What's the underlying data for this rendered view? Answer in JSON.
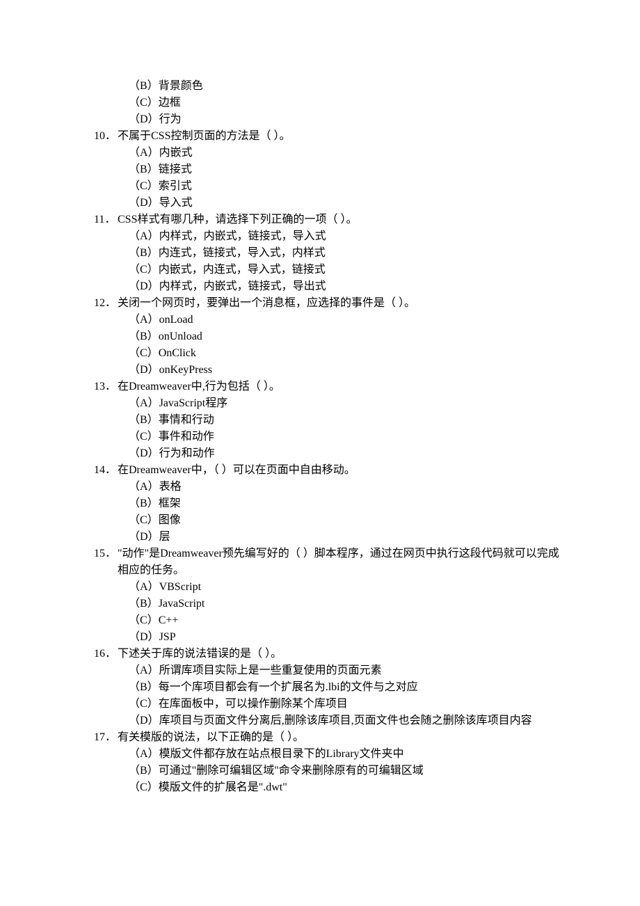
{
  "preOptions": [
    {
      "label": "（B）",
      "text": "背景颜色"
    },
    {
      "label": "（C）",
      "text": "边框"
    },
    {
      "label": "（D）",
      "text": "行为"
    }
  ],
  "questions": [
    {
      "num": "10．",
      "text": "不属于CSS控制页面的方法是（  ）。",
      "options": [
        {
          "label": "（A）",
          "text": "内嵌式"
        },
        {
          "label": "（B）",
          "text": "链接式"
        },
        {
          "label": "（C）",
          "text": "索引式"
        },
        {
          "label": "（D）",
          "text": "导入式"
        }
      ]
    },
    {
      "num": "11．",
      "text": "CSS样式有哪几种，请选择下列正确的一项（  ）。",
      "options": [
        {
          "label": "（A）",
          "text": "内样式，内嵌式，链接式，导入式"
        },
        {
          "label": "（B）",
          "text": "内连式，链接式，导入式，内样式"
        },
        {
          "label": "（C）",
          "text": "内嵌式，内连式，导入式，链接式"
        },
        {
          "label": "（D）",
          "text": "内样式，内嵌式，链接式，导出式"
        }
      ]
    },
    {
      "num": "12．",
      "text": "关闭一个网页时，要弹出一个消息框，应选择的事件是（  ）。",
      "options": [
        {
          "label": "（A）",
          "text": "onLoad"
        },
        {
          "label": "（B）",
          "text": "onUnload"
        },
        {
          "label": "（C）",
          "text": "OnClick"
        },
        {
          "label": "（D）",
          "text": "onKeyPress"
        }
      ]
    },
    {
      "num": "13．",
      "text": "在Dreamweaver中,行为包括（  ）。",
      "options": [
        {
          "label": "（A）",
          "text": "JavaScript程序"
        },
        {
          "label": "（B）",
          "text": "事情和行动"
        },
        {
          "label": "（C）",
          "text": "事件和动作"
        },
        {
          "label": "（D）",
          "text": "行为和动作"
        }
      ]
    },
    {
      "num": "14．",
      "text": "在Dreamweaver中，（  ）可以在页面中自由移动。",
      "options": [
        {
          "label": "（A）",
          "text": "表格"
        },
        {
          "label": "（B）",
          "text": "框架"
        },
        {
          "label": "（C）",
          "text": "图像"
        },
        {
          "label": "（D）",
          "text": "层"
        }
      ]
    },
    {
      "num": "15．",
      "text": "\"动作\"是Dreamweaver预先编写好的（  ）脚本程序，通过在网页中执行这段代码就可以完成相应的任务。",
      "options": [
        {
          "label": "（A）",
          "text": "VBScript"
        },
        {
          "label": "（B）",
          "text": "JavaScript"
        },
        {
          "label": "（C）",
          "text": "C++"
        },
        {
          "label": "（D）",
          "text": "JSP"
        }
      ]
    },
    {
      "num": "16．",
      "text": "下述关于库的说法错误的是（  ）。",
      "options": [
        {
          "label": "（A）",
          "text": "所谓库项目实际上是一些重复使用的页面元素"
        },
        {
          "label": "（B）",
          "text": "每一个库项目都会有一个扩展名为.lbi的文件与之对应"
        },
        {
          "label": "（C）",
          "text": "在库面板中，可以操作删除某个库项目"
        },
        {
          "label": "（D）",
          "text": "库项目与页面文件分离后,删除该库项目,页面文件也会随之删除该库项目内容"
        }
      ]
    },
    {
      "num": "17．",
      "text": "有关模版的说法，以下正确的是（  ）。",
      "options": [
        {
          "label": "（A）",
          "text": "模版文件都存放在站点根目录下的Library文件夹中"
        },
        {
          "label": "（B）",
          "text": "可通过\"删除可编辑区域\"命令来删除原有的可编辑区域"
        },
        {
          "label": "（C）",
          "text": "模版文件的扩展名是\".dwt\""
        }
      ]
    }
  ]
}
